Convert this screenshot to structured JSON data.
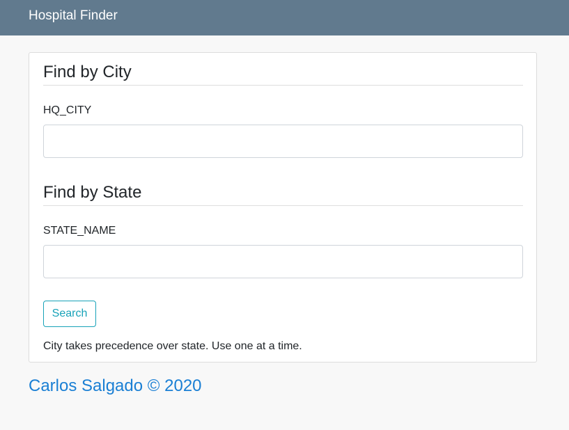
{
  "header": {
    "brand": "Hospital Finder",
    "background_color": "#617a8e"
  },
  "city_section": {
    "title": "Find by City",
    "field_label": "HQ_CITY",
    "value": "",
    "placeholder": ""
  },
  "state_section": {
    "title": "Find by State",
    "field_label": "STATE_NAME",
    "value": "",
    "placeholder": ""
  },
  "search_button": {
    "label": "Search",
    "color": "#17a2b8"
  },
  "help_text": "City takes precedence over state. Use one at a time.",
  "footer": {
    "text": "Carlos Salgado © 2020",
    "color": "#1a7fd4"
  }
}
